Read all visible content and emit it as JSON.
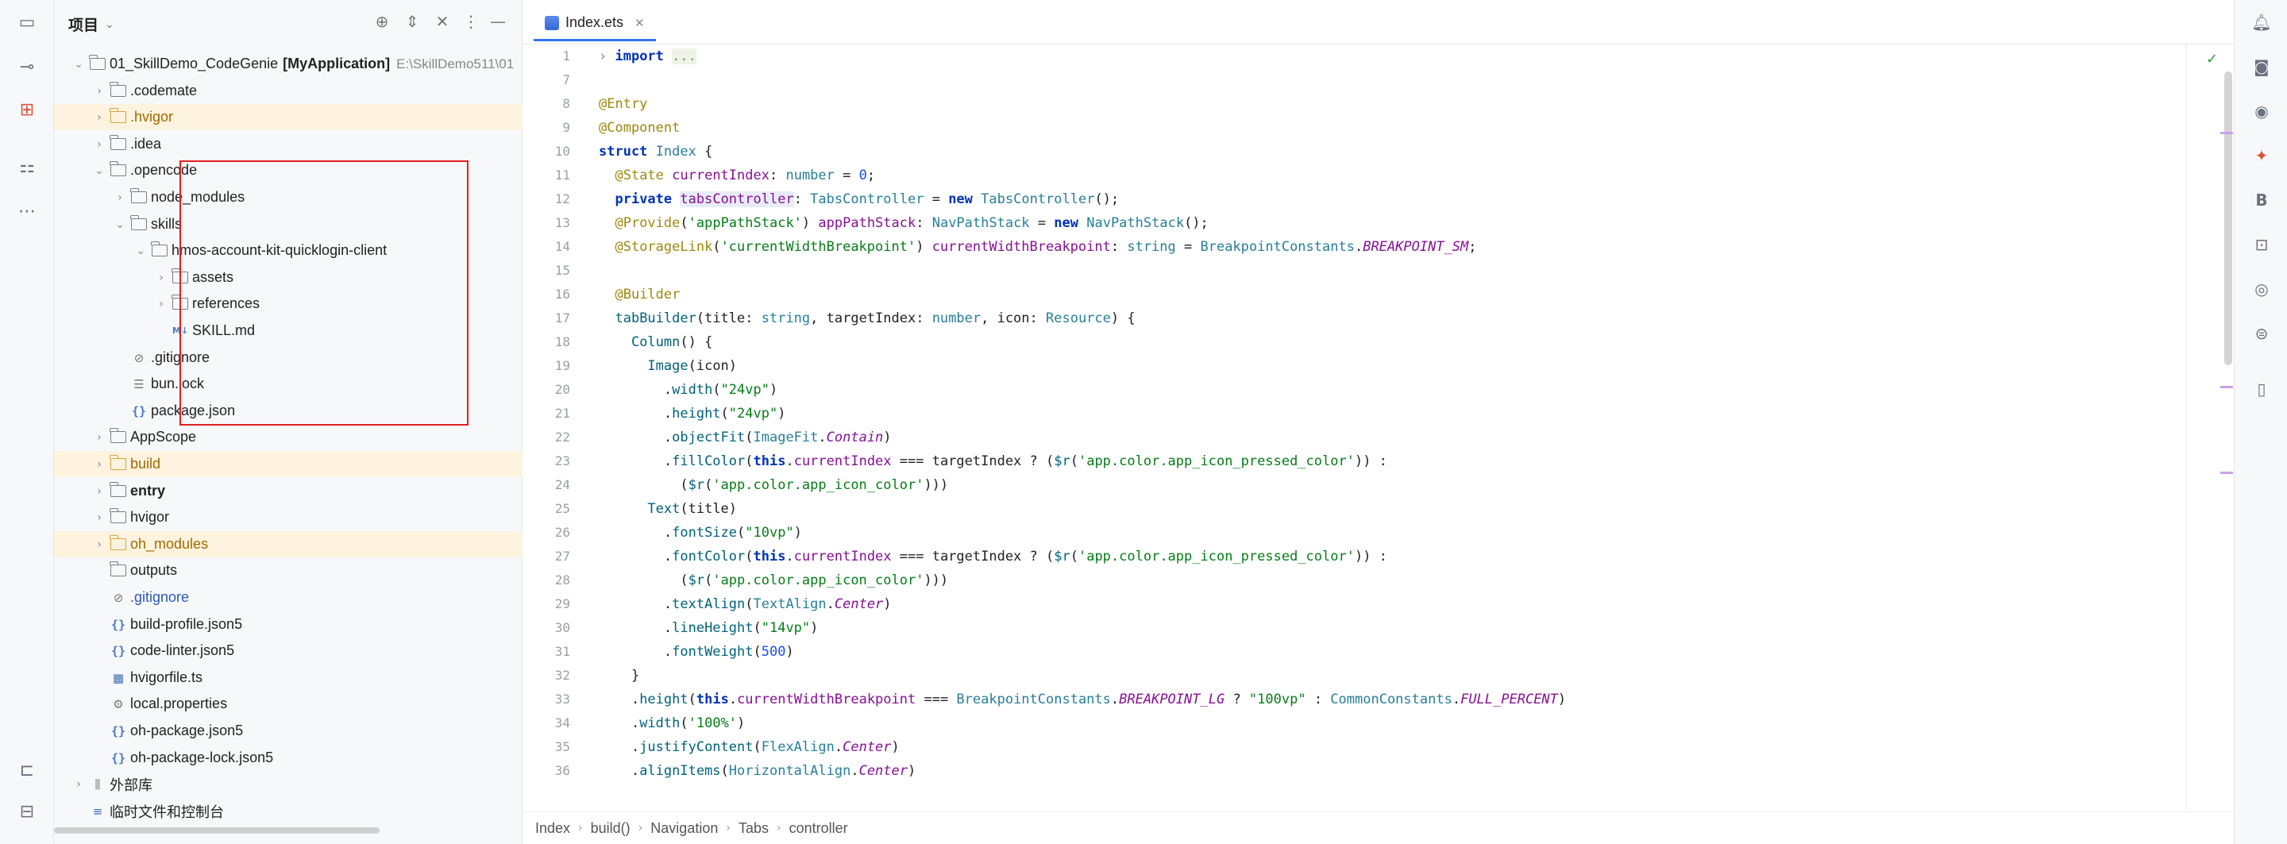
{
  "project_panel": {
    "title": "项目",
    "tree": [
      {
        "depth": 0,
        "arrow": "⌄",
        "kind": "folder",
        "label": "01_SkillDemo_CodeGenie",
        "module": "[MyApplication]",
        "suffix": "E:\\SkillDemo511\\01"
      },
      {
        "depth": 1,
        "arrow": "›",
        "kind": "folder",
        "label": ".codemate"
      },
      {
        "depth": 1,
        "arrow": "›",
        "kind": "folder-orange",
        "label": ".hvigor",
        "highlight": true
      },
      {
        "depth": 1,
        "arrow": "›",
        "kind": "folder",
        "label": ".idea"
      },
      {
        "depth": 1,
        "arrow": "⌄",
        "kind": "folder",
        "label": ".opencode"
      },
      {
        "depth": 2,
        "arrow": "›",
        "kind": "folder",
        "label": "node_modules"
      },
      {
        "depth": 2,
        "arrow": "⌄",
        "kind": "folder",
        "label": "skills"
      },
      {
        "depth": 3,
        "arrow": "⌄",
        "kind": "folder",
        "label": "hmos-account-kit-quicklogin-client"
      },
      {
        "depth": 4,
        "arrow": "›",
        "kind": "folder",
        "label": "assets"
      },
      {
        "depth": 4,
        "arrow": "›",
        "kind": "folder",
        "label": "references"
      },
      {
        "depth": 4,
        "arrow": "",
        "kind": "md",
        "label": "SKILL.md"
      },
      {
        "depth": 2,
        "arrow": "",
        "kind": "ignore",
        "label": ".gitignore"
      },
      {
        "depth": 2,
        "arrow": "",
        "kind": "lines",
        "label": "bun.lock"
      },
      {
        "depth": 2,
        "arrow": "",
        "kind": "json",
        "label": "package.json"
      },
      {
        "depth": 1,
        "arrow": "›",
        "kind": "folder",
        "label": "AppScope"
      },
      {
        "depth": 1,
        "arrow": "›",
        "kind": "folder-orange",
        "label": "build",
        "highlight": true
      },
      {
        "depth": 1,
        "arrow": "›",
        "kind": "folder",
        "label": "entry",
        "bold": true
      },
      {
        "depth": 1,
        "arrow": "›",
        "kind": "folder",
        "label": "hvigor"
      },
      {
        "depth": 1,
        "arrow": "›",
        "kind": "folder-orange",
        "label": "oh_modules",
        "highlight": true
      },
      {
        "depth": 1,
        "arrow": "",
        "kind": "folder",
        "label": "outputs"
      },
      {
        "depth": 1,
        "arrow": "",
        "kind": "ignore",
        "label": ".gitignore",
        "blue": true
      },
      {
        "depth": 1,
        "arrow": "",
        "kind": "json",
        "label": "build-profile.json5"
      },
      {
        "depth": 1,
        "arrow": "",
        "kind": "json",
        "label": "code-linter.json5"
      },
      {
        "depth": 1,
        "arrow": "",
        "kind": "ts",
        "label": "hvigorfile.ts"
      },
      {
        "depth": 1,
        "arrow": "",
        "kind": "gear",
        "label": "local.properties"
      },
      {
        "depth": 1,
        "arrow": "",
        "kind": "json",
        "label": "oh-package.json5"
      },
      {
        "depth": 1,
        "arrow": "",
        "kind": "json",
        "label": "oh-package-lock.json5"
      },
      {
        "depth": 0,
        "arrow": "›",
        "kind": "lib",
        "label": "外部库"
      },
      {
        "depth": 0,
        "arrow": "",
        "kind": "scratch",
        "label": "临时文件和控制台"
      }
    ]
  },
  "editor": {
    "tab_label": "Index.ets",
    "line_numbers": [
      "1",
      "7",
      "8",
      "9",
      "10",
      "11",
      "12",
      "13",
      "14",
      "15",
      "16",
      "17",
      "18",
      "19",
      "20",
      "21",
      "22",
      "23",
      "24",
      "25",
      "26",
      "27",
      "28",
      "29",
      "30",
      "31",
      "32",
      "33",
      "34",
      "35",
      "36"
    ],
    "breadcrumb": [
      "Index",
      "build()",
      "Navigation",
      "Tabs",
      "controller"
    ]
  },
  "colors": {
    "accent": "#3574f0",
    "highlight_box": "#e02020",
    "excluded_folder_bg": "#fdf3df"
  },
  "icons": {
    "left_bar": [
      "folder-icon",
      "commit-icon",
      "structure-icon",
      "bookmarks-icon",
      "more-icon",
      "run-icon",
      "layers-icon"
    ],
    "right_bar": [
      "notifications-icon",
      "codegenie-icon",
      "preview-icon",
      "ai-icon",
      "bold-b-icon",
      "device-icon",
      "inspector-icon",
      "emulator-icon",
      "phone-icon"
    ]
  }
}
